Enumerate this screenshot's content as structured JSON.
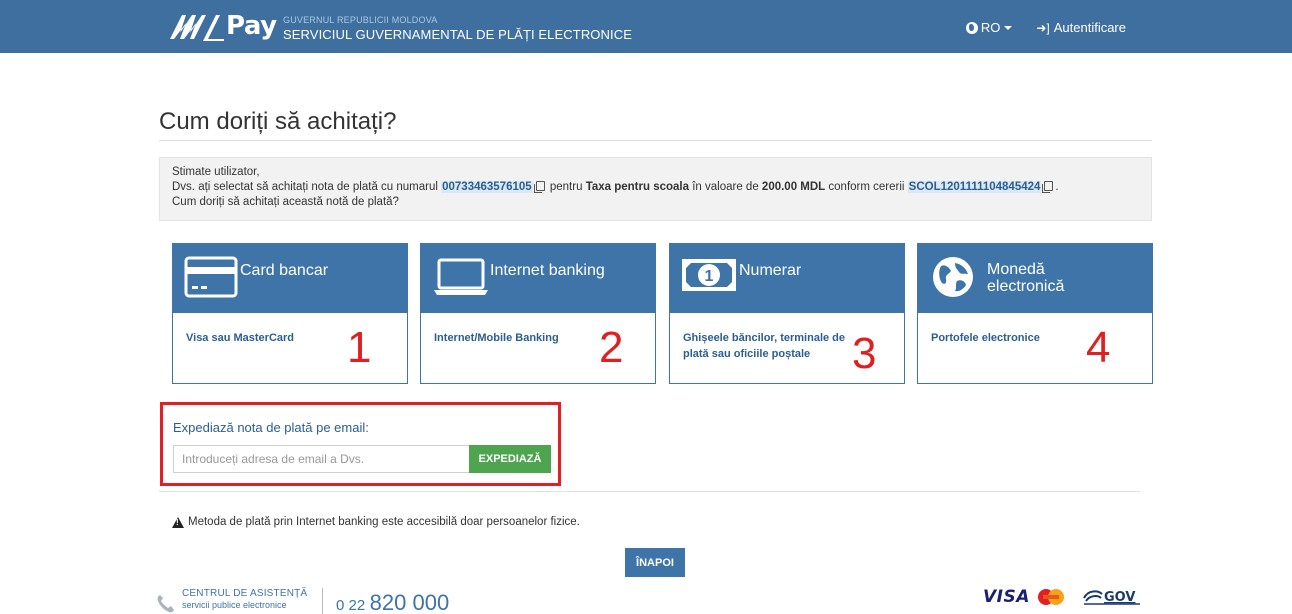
{
  "header": {
    "logo_text": "Pay",
    "gov_small": "GUVERNUL REPUBLICII MOLDOVA",
    "gov_big": "SERVICIUL GUVERNAMENTAL DE PLĂȚI ELECTRONICE",
    "language": "RO",
    "login": "Autentificare"
  },
  "page": {
    "title": "Cum doriți să achitați?"
  },
  "info": {
    "greeting": "Stimate utilizator,",
    "line2_a": "Dvs. ați selectat să achitați nota de plată cu numarul",
    "invoice_number": "00733463576105",
    "line2_b": "pentru",
    "service_name": "Taxa pentru scoala",
    "line2_c": "în valoare de",
    "amount": "200.00 MDL",
    "line2_d": "conform cererii",
    "request_id": "SCOL1201111104845424",
    "line3": "Cum doriți să achitați această notă de plată?"
  },
  "methods": [
    {
      "title": "Card bancar",
      "description": "Visa sau MasterCard",
      "number": "1",
      "icon": "credit-card-icon"
    },
    {
      "title": "Internet banking",
      "description": "Internet/Mobile Banking",
      "number": "2",
      "icon": "laptop-icon"
    },
    {
      "title": "Numerar",
      "description": "Ghișeele băncilor, terminale de plată sau oficiile poștale",
      "number": "3",
      "icon": "cash-icon"
    },
    {
      "title_line1": "Monedă",
      "title_line2": "electronică",
      "description": "Portofele electronice",
      "number": "4",
      "icon": "globe-icon"
    }
  ],
  "email": {
    "label": "Expediază nota de plată pe email:",
    "placeholder": "Introduceți adresa de email a Dvs.",
    "button": "EXPEDIAZĂ"
  },
  "notice": "Metoda de plată prin Internet banking este accesibilă doar persoanelor fizice.",
  "back_button": "ÎNAPOI",
  "footer": {
    "helpdesk_title": "CENTRUL DE ASISTENȚĂ",
    "helpdesk_sub": "servicii publice electronice",
    "phone_prefix": "0 22",
    "phone_main": "820 000",
    "visa": "VISA",
    "mgov": "GOV"
  },
  "colors": {
    "header_bg": "#3e6f9f",
    "card_blue": "#3e74a8",
    "annotation_red": "#e02020",
    "send_green": "#4fa54f"
  }
}
